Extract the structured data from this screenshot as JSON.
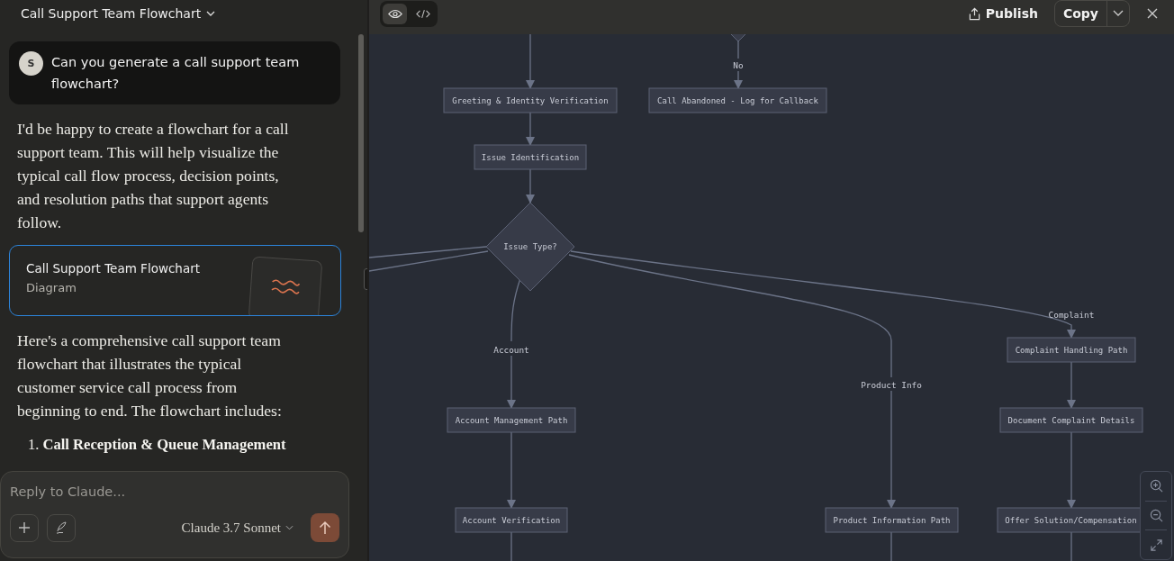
{
  "chat": {
    "title": "Call Support Team Flowchart",
    "user_message": {
      "avatar": "S",
      "text": "Can you generate a call support team flowchart?"
    },
    "reply_intro": "I'd be happy to create a flowchart for a call support team. This will help visualize the typical call flow process, decision points, and resolution paths that support agents follow.",
    "artifact": {
      "title": "Call Support Team Flowchart",
      "type": "Diagram"
    },
    "reply_body": "Here's a comprehensive call support team flowchart that illustrates the typical customer service call process from beginning to end. The flowchart includes:",
    "list": [
      {
        "number": "1.",
        "title": "Call Reception & Queue Management"
      }
    ]
  },
  "composer": {
    "placeholder": "Reply to Claude...",
    "model": "Claude 3.7 Sonnet"
  },
  "artifact_toolbar": {
    "views": [
      {
        "kind": "preview",
        "selected": true
      },
      {
        "kind": "code",
        "selected": false
      }
    ],
    "publish": "Publish",
    "copy": "Copy"
  },
  "flowchart": {
    "nodes": [
      {
        "kind": "process",
        "label": "Greeting & Identity Verification"
      },
      {
        "kind": "process",
        "label": "Call Abandoned - Log for Callback"
      },
      {
        "kind": "process",
        "label": "Issue Identification"
      },
      {
        "kind": "decision",
        "label": "Issue Type?"
      },
      {
        "kind": "process",
        "label": "Complaint Handling Path"
      },
      {
        "kind": "process",
        "label": "Account Management Path"
      },
      {
        "kind": "process",
        "label": "Document Complaint Details"
      },
      {
        "kind": "process",
        "label": "Account Verification"
      },
      {
        "kind": "process",
        "label": "Product Information Path"
      },
      {
        "kind": "process",
        "label": "Offer Solution/Compensation"
      }
    ],
    "edge_labels": [
      "No",
      "Account",
      "Product Info",
      "Complaint"
    ]
  }
}
